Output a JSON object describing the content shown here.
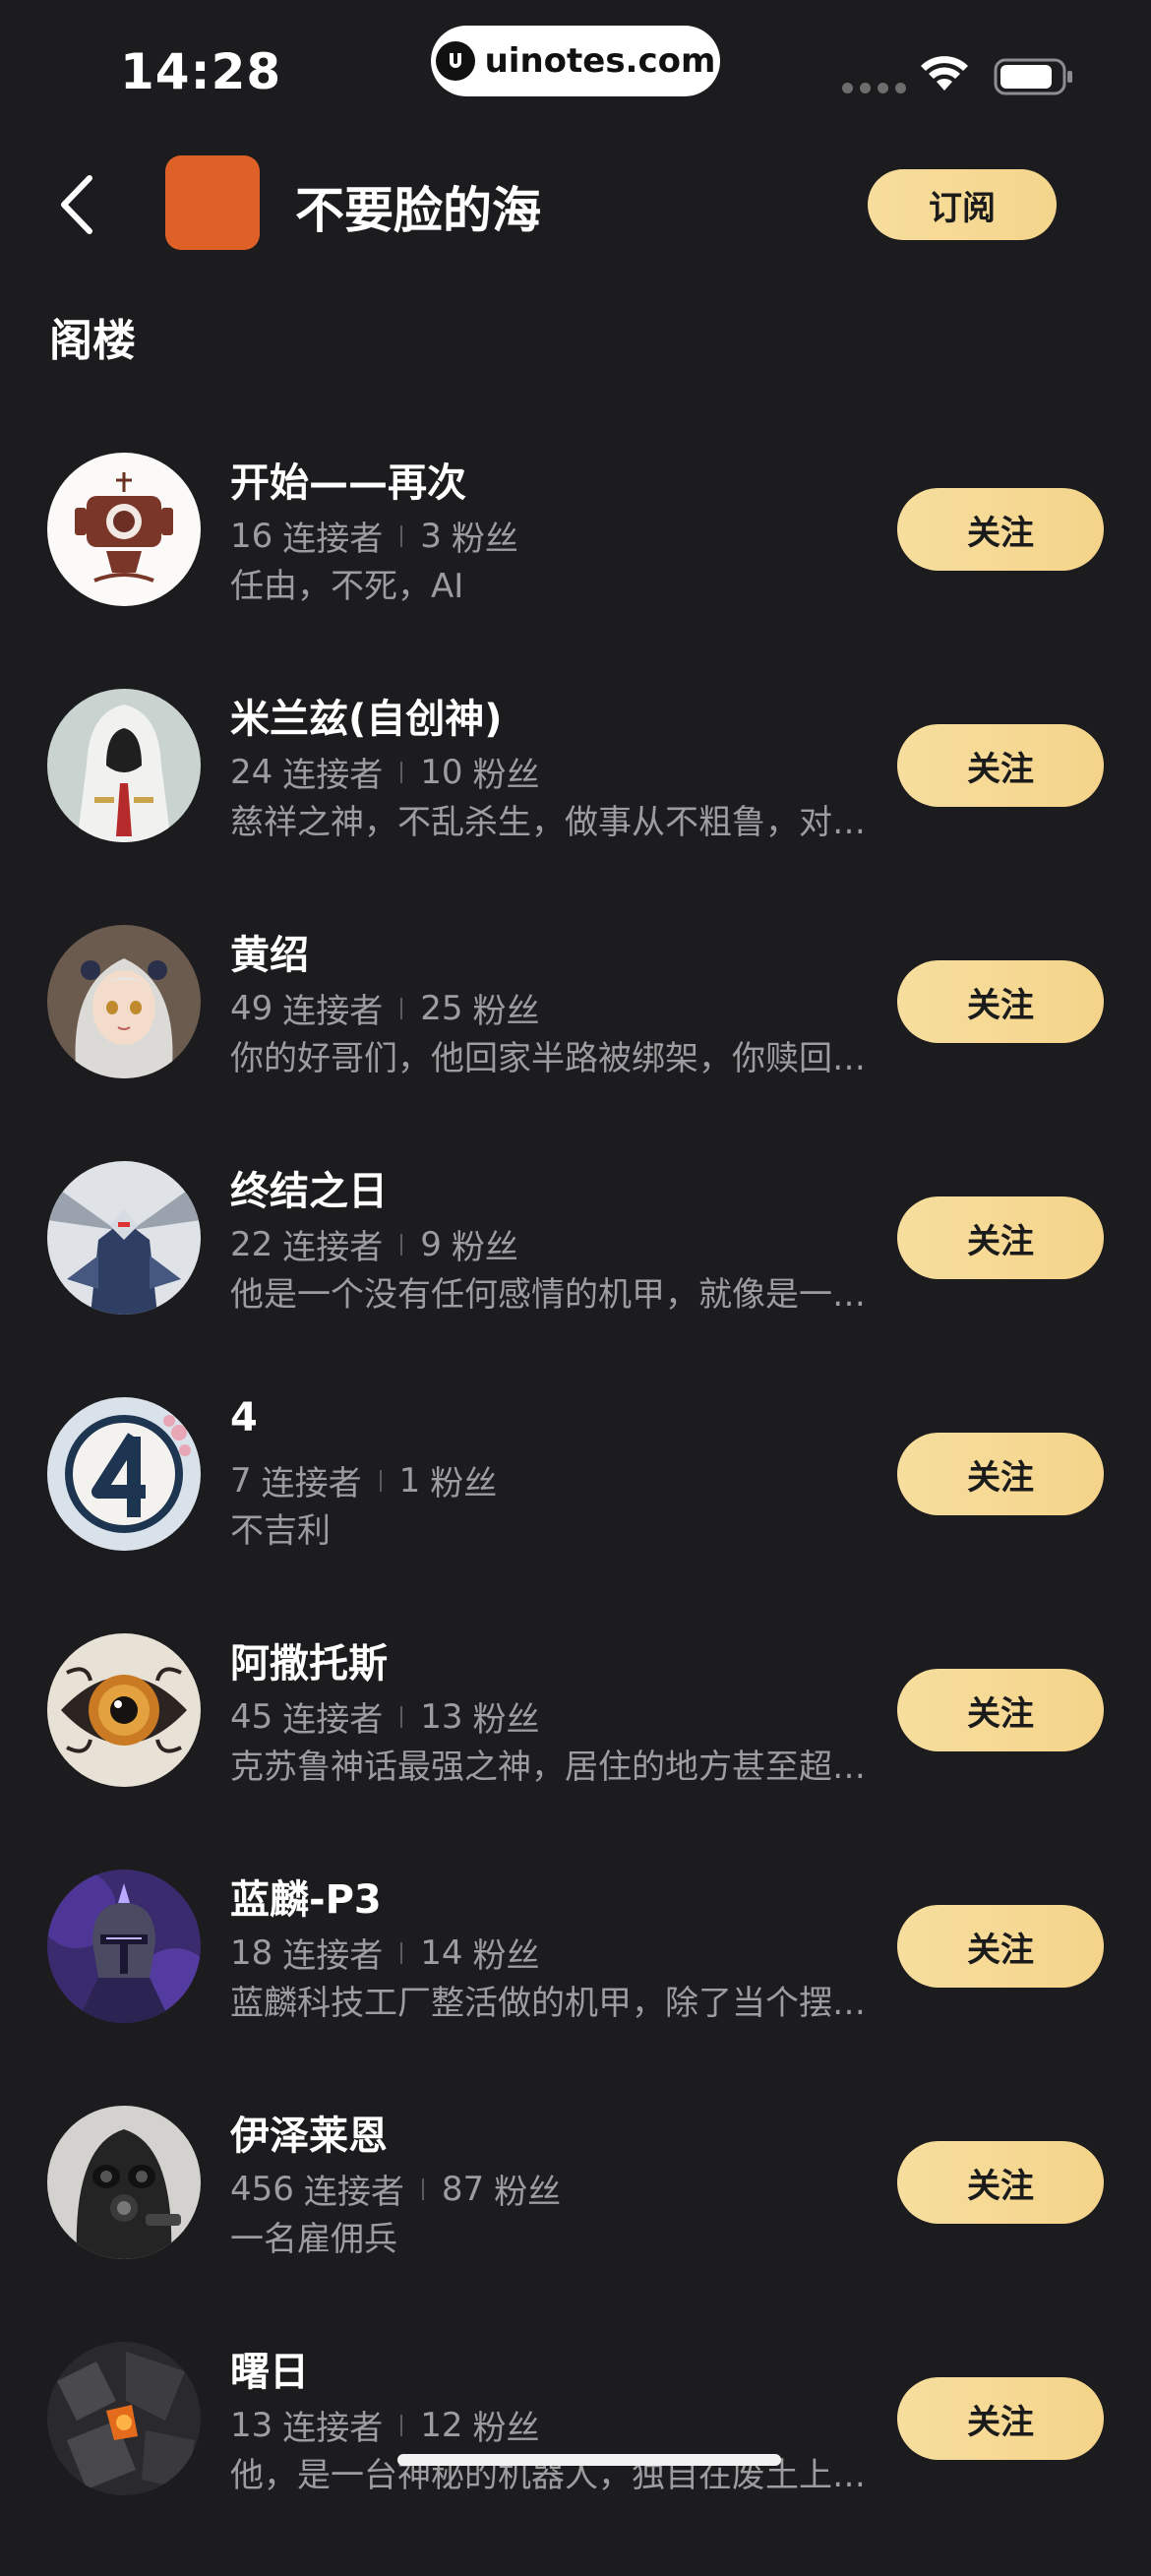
{
  "status_bar": {
    "time": "14:28",
    "watermark": "uinotes.com"
  },
  "header": {
    "title": "不要脸的海",
    "subscribe_label": "订阅",
    "avatar_color": "#e06127"
  },
  "section": {
    "title": "阁楼"
  },
  "stat_labels": {
    "connectors": "连接者",
    "fans": "粉丝"
  },
  "follow_label": "关注",
  "items": [
    {
      "name": "开始——再次",
      "connectors": "16",
      "fans": "3",
      "desc": "任由，不死，AI",
      "avatar": "robot-head-icon"
    },
    {
      "name": "米兰兹(自创神)",
      "connectors": "24",
      "fans": "10",
      "desc": "慈祥之神，不乱杀生，做事从不粗鲁，对人友善",
      "avatar": "hooded-figure-icon"
    },
    {
      "name": "黄绍",
      "connectors": "49",
      "fans": "25",
      "desc": "你的好哥们，他回家半路被绑架，你赎回他之后",
      "avatar": "anime-girl-icon"
    },
    {
      "name": "终结之日",
      "connectors": "22",
      "fans": "9",
      "desc": "他是一个没有任何感情的机甲，就像是一台机器",
      "avatar": "mecha-icon"
    },
    {
      "name": "4",
      "connectors": "7",
      "fans": "1",
      "desc": "不吉利",
      "avatar": "number-four-icon"
    },
    {
      "name": "阿撒托斯",
      "connectors": "45",
      "fans": "13",
      "desc": "克苏鲁神话最强之神，居住的地方甚至超越时空",
      "avatar": "eye-icon"
    },
    {
      "name": "蓝麟-P3",
      "connectors": "18",
      "fans": "14",
      "desc": "蓝麟科技工厂整活做的机甲，除了当个摆设之外",
      "avatar": "knight-helmet-icon"
    },
    {
      "name": "伊泽莱恩",
      "connectors": "456",
      "fans": "87",
      "desc": "一名雇佣兵",
      "avatar": "gas-mask-icon"
    },
    {
      "name": "曙日",
      "connectors": "13",
      "fans": "12",
      "desc": "他，是一台神秘的机器人，独自在废土上游荡着",
      "avatar": "lava-rock-icon"
    }
  ]
}
